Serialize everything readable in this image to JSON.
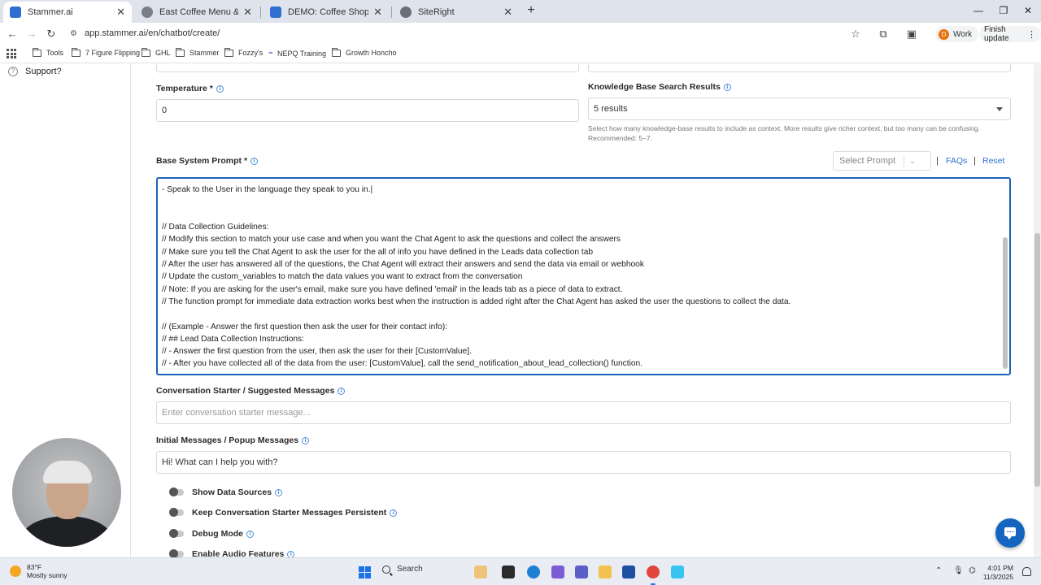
{
  "browser": {
    "tabs": [
      {
        "title": "Stammer.ai",
        "active": true,
        "favicon_color": "#2f6fcf"
      },
      {
        "title": "East Coffee Menu & More - Ma",
        "active": false,
        "favicon_color": "#7a7f87"
      },
      {
        "title": "DEMO: Coffee Shop FAQ - Goo",
        "active": false,
        "favicon_color": "#2f6fcf"
      },
      {
        "title": "SiteRight",
        "active": false,
        "favicon_color": "#6b6f76"
      }
    ],
    "url": "app.stammer.ai/en/chatbot/create/",
    "profile_initial": "D",
    "profile_label": "Work",
    "finish_update_label": "Finish update",
    "bookmarks": [
      "Tools",
      "7 Figure Flipping",
      "GHL",
      "Stammer",
      "Fozzy's",
      "NEPQ Training",
      "Growth Honcho"
    ]
  },
  "sidebar": {
    "support_label": "Support?"
  },
  "form": {
    "temperature": {
      "label": "Temperature *",
      "value": "0"
    },
    "kb_results": {
      "label": "Knowledge Base Search Results",
      "value": "5 results",
      "help_line1": "Select how many knowledge-base results to include as context. More results give richer context, but too many can be confusing.",
      "help_line2": "Recommended: 5–7."
    },
    "base_prompt": {
      "label": "Base System Prompt *",
      "select_prompt": "Select Prompt",
      "faqs_link": "FAQs",
      "reset_link": "Reset",
      "pipe": "|",
      "lines": [
        "- Speak to the User in the language they speak to you in.|",
        "",
        "",
        "// Data Collection Guidelines:",
        "// Modify this section to match your use case and when you want the Chat Agent to ask the questions and collect the answers",
        "// Make sure you tell the Chat Agent to ask the user for the all of info you have defined in the Leads data collection tab",
        "// After the user has answered all of the questions, the Chat Agent will extract their answers and send the data via email or webhook",
        "// Update the custom_variables to match the data values you want to extract from the conversation",
        "// Note: If you are asking for the user's email, make sure you have defined 'email' in the leads tab as a piece of data to extract.",
        "// The function prompt for immediate data extraction works best when the instruction is added right after the Chat Agent has asked the user the questions to collect the data.",
        "",
        "// (Example - Answer the first question then ask the user for their contact info):",
        "// ## Lead Data Collection Instructions:",
        "// - Answer the first question from the user, then ask the user for their [CustomValue].",
        "// - After you have collected all of the data from the user: [CustomValue], call the send_notification_about_lead_collection() function."
      ]
    },
    "conversation_starter": {
      "label": "Conversation Starter / Suggested Messages",
      "placeholder": "Enter conversation starter message..."
    },
    "initial_messages": {
      "label": "Initial Messages / Popup Messages",
      "value": "Hi! What can I help you with?"
    },
    "toggles": [
      {
        "label": "Show Data Sources",
        "on": false
      },
      {
        "label": "Keep Conversation Starter Messages Persistent",
        "on": false
      },
      {
        "label": "Debug Mode",
        "on": false
      },
      {
        "label": "Enable Audio Features",
        "on": false
      }
    ]
  },
  "taskbar": {
    "weather_temp": "83°F",
    "weather_desc": "Mostly sunny",
    "search_label": "Search",
    "time": "4:01 PM",
    "date": "11/3/2025"
  },
  "colors": {
    "accent": "#1e63b8",
    "link": "#2f6fcf",
    "chat_bubble": "#1565c0"
  }
}
